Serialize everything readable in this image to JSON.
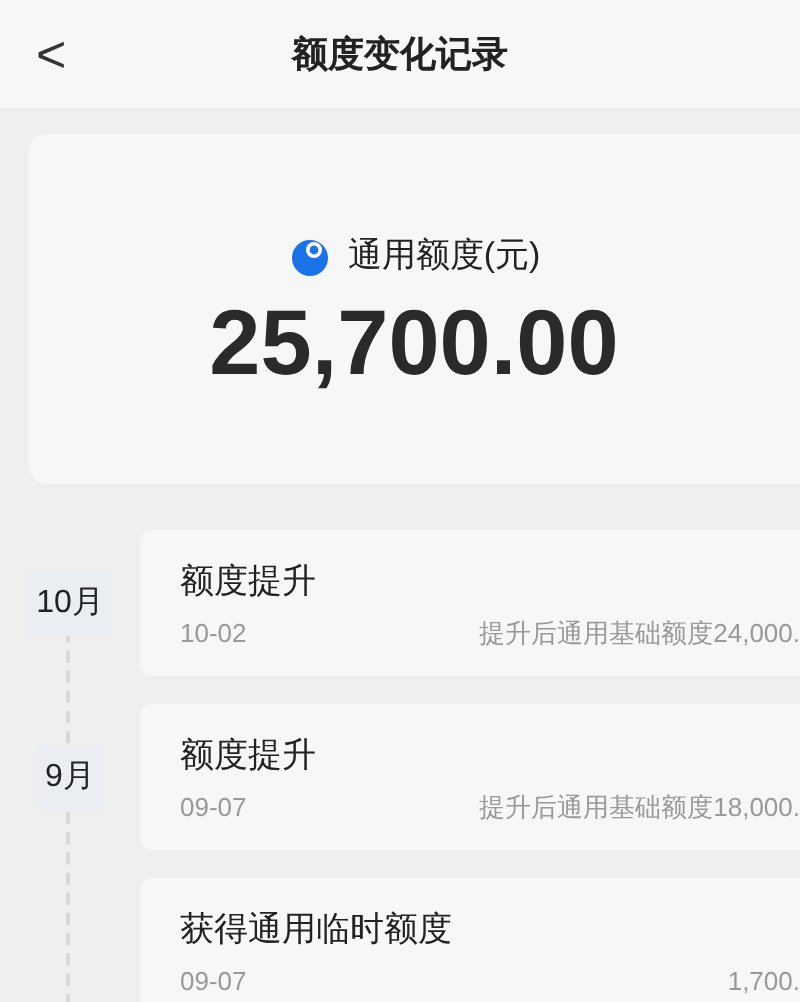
{
  "header": {
    "back": "<",
    "title": "额度变化记录"
  },
  "summary": {
    "label": "通用额度(元)",
    "amount": "25,700.00"
  },
  "timeline": [
    {
      "month": "10月",
      "records": [
        {
          "title": "额度提升",
          "date": "10-02",
          "detail": "提升后通用基础额度24,000."
        }
      ]
    },
    {
      "month": "9月",
      "records": [
        {
          "title": "额度提升",
          "date": "09-07",
          "detail": "提升后通用基础额度18,000."
        },
        {
          "title": "获得通用临时额度",
          "date": "09-07",
          "detail": "1,700."
        }
      ]
    }
  ]
}
